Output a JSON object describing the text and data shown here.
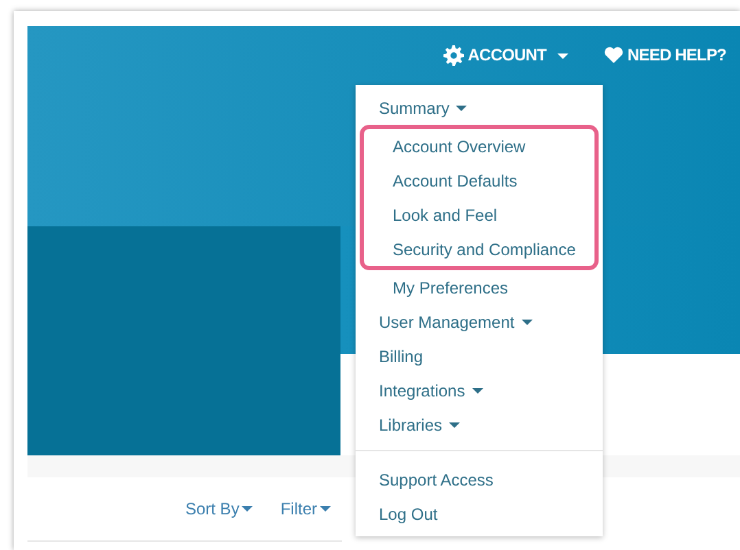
{
  "header": {
    "account_menu": {
      "label": "ACCOUNT",
      "expanded": true
    },
    "help_link": {
      "label": "NEED HELP?"
    }
  },
  "account_dropdown": {
    "sections": [
      {
        "items": [
          {
            "label": "Summary",
            "has_caret": true,
            "children": [
              {
                "label": "Account Overview",
                "highlighted": true
              },
              {
                "label": "Account Defaults",
                "highlighted": true
              },
              {
                "label": "Look and Feel",
                "highlighted": true
              },
              {
                "label": "Security and Compliance",
                "highlighted": true
              },
              {
                "label": "My Preferences",
                "highlighted": false
              }
            ]
          },
          {
            "label": "User Management",
            "has_caret": true
          },
          {
            "label": "Billing",
            "has_caret": false
          },
          {
            "label": "Integrations",
            "has_caret": true
          },
          {
            "label": "Libraries",
            "has_caret": true
          }
        ]
      },
      {
        "items": [
          {
            "label": "Support Access",
            "has_caret": false
          },
          {
            "label": "Log Out",
            "has_caret": false
          }
        ]
      }
    ]
  },
  "toolbar": {
    "sort_label": "Sort By",
    "filter_label": "Filter"
  }
}
